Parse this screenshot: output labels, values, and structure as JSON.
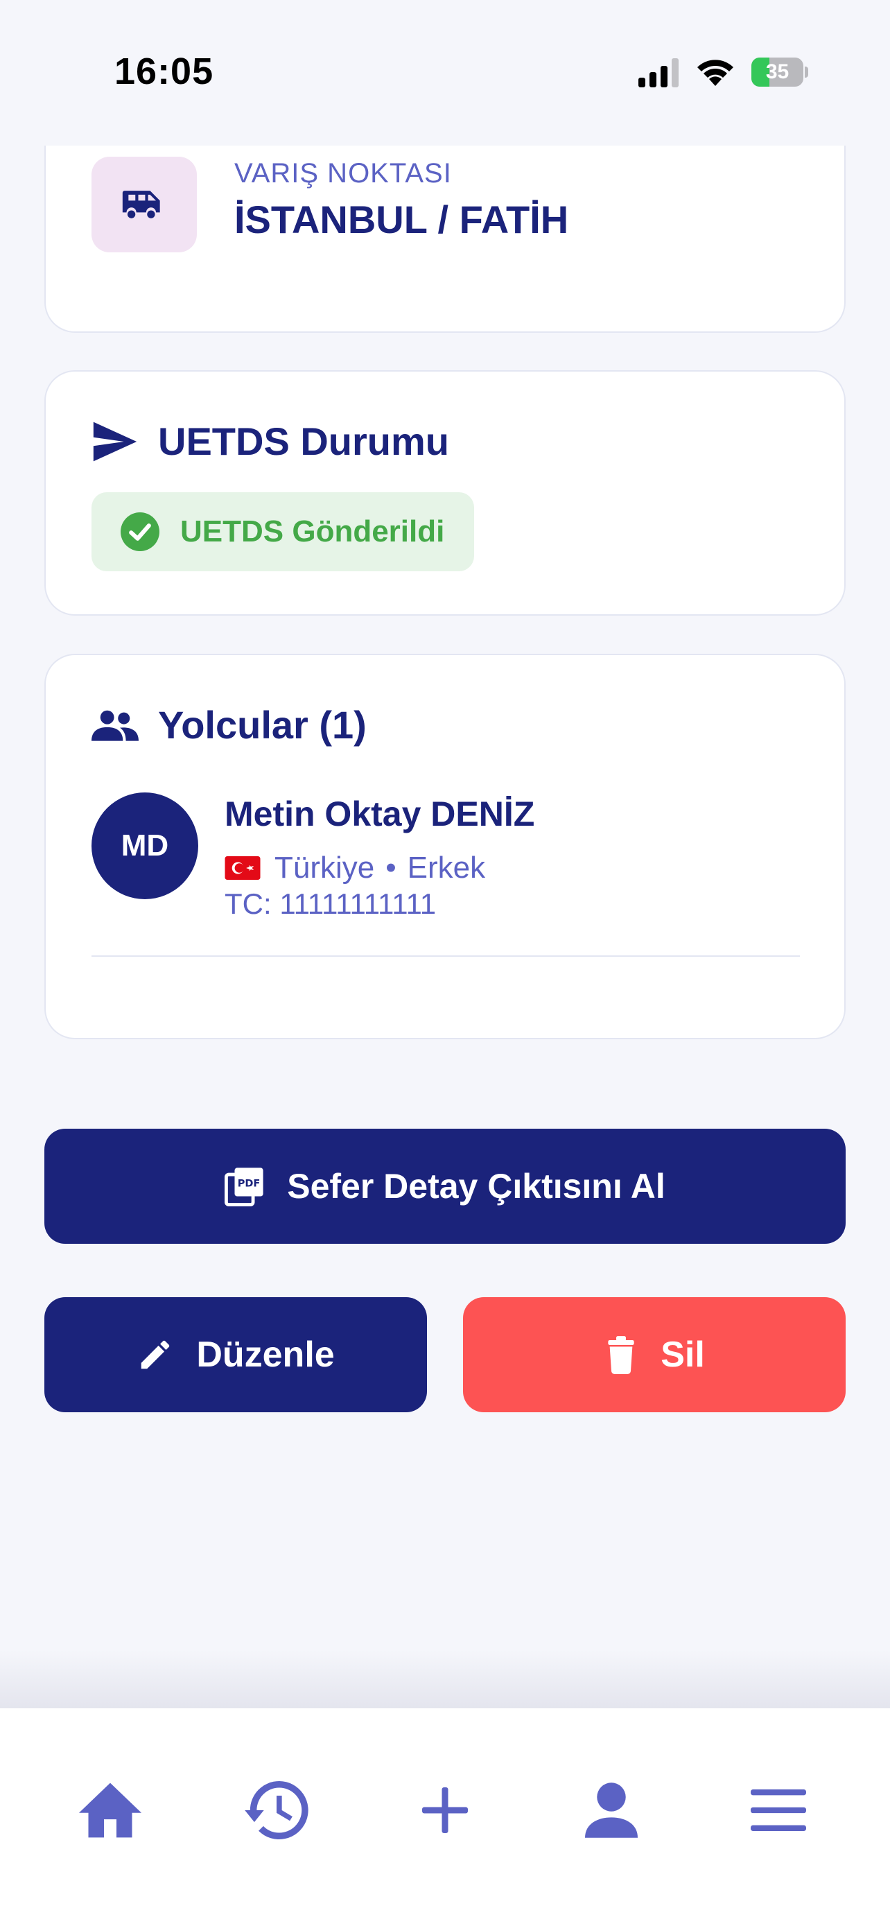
{
  "status_bar": {
    "time": "16:05",
    "battery": "35",
    "battery_level": 0.35
  },
  "destination": {
    "label": "VARIŞ NOKTASI",
    "value": "İSTANBUL / FATİH",
    "icon": "van-icon"
  },
  "uetds": {
    "title": "UETDS Durumu",
    "status": "UETDS Gönderildi",
    "icon": "send-icon"
  },
  "passengers": {
    "title": "Yolcular (1)",
    "items": [
      {
        "initials": "MD",
        "name": "Metin Oktay DENİZ",
        "country": "Türkiye",
        "separator": "•",
        "gender": "Erkek",
        "tc": "TC: 11111111111"
      }
    ]
  },
  "actions": {
    "pdf_label": "Sefer Detay Çıktısını Al",
    "edit_label": "Düzenle",
    "delete_label": "Sil"
  },
  "colors": {
    "primary": "#1b237b",
    "accent": "#5b62c4",
    "danger": "#fd5353",
    "success": "#44a948",
    "background": "#f5f6fb"
  },
  "nav": [
    "home-icon",
    "history-icon",
    "add-icon",
    "profile-icon",
    "menu-icon"
  ]
}
